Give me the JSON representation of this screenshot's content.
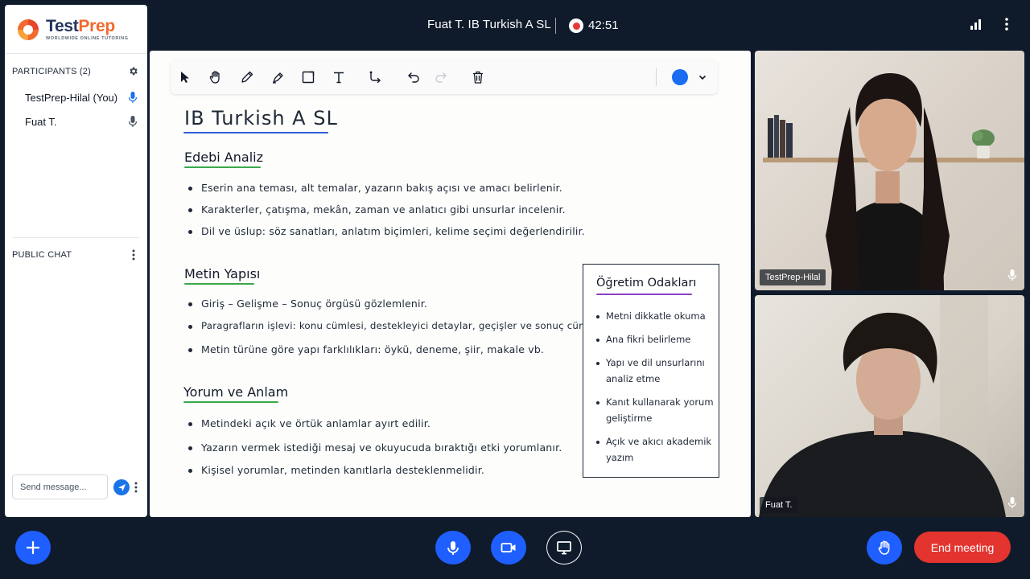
{
  "header": {
    "meeting_title": "Fuat T. IB Turkish A SL",
    "timer": "42:51",
    "icons": [
      "recording-icon",
      "signal-icon",
      "more-vertical-icon"
    ]
  },
  "sidebar": {
    "logo": {
      "text_main": "Test",
      "text_accent": "Prep",
      "tagline": "WORLDWIDE ONLINE TUTORING"
    },
    "participants_title": "PARTICIPANTS (2)",
    "participants": [
      {
        "name": "TestPrep-Hilal (You)",
        "mic_active": true
      },
      {
        "name": "Fuat T.",
        "mic_active": false
      }
    ],
    "chat_title": "PUBLIC CHAT",
    "chat_placeholder": "Send message..."
  },
  "whiteboard": {
    "toolbar": {
      "tools": [
        "select-tool",
        "pan-tool",
        "pencil-tool",
        "highlighter-tool",
        "shape-tool",
        "text-tool",
        "connector-tool",
        "undo",
        "redo",
        "delete"
      ],
      "active_color": "#1a6cf0"
    },
    "title": "IB Turkish A SL",
    "sections": [
      {
        "heading": "Edebi Analiz",
        "bullets": [
          "Eserin ana teması, alt temalar, yazarın bakış açısı ve amacı belirlenir.",
          "Karakterler, çatışma, mekân, zaman ve anlatıcı gibi unsurlar incelenir.",
          "Dil ve üslup: söz sanatları, anlatım biçimleri, kelime seçimi değerlendirilir."
        ]
      },
      {
        "heading": "Metin Yapısı",
        "bullets": [
          "Giriş – Gelişme – Sonuç örgüsü gözlemlenir.",
          "Paragrafların işlevi: konu cümlesi, destekleyici detaylar, geçişler ve sonuç cümlesi.",
          "Metin türüne göre yapı farklılıkları: öykü, deneme, şiir, makale vb."
        ]
      },
      {
        "heading": "Yorum ve Anlam",
        "bullets": [
          "Metindeki açık ve örtük anlamlar ayırt edilir.",
          "Yazarın vermek istediği mesaj ve okuyucuda bıraktığı etki yorumlanır.",
          "Kişisel yorumlar, metinden kanıtlarla desteklenmelidir."
        ]
      }
    ],
    "focus_box": {
      "title": "Öğretim Odakları",
      "items": [
        "Metni dikkatle okuma",
        "Ana fikri belirleme",
        "Yapı ve dil unsurlarını analiz etme",
        "Kanıt kullanarak yorum geliştirme",
        "Açık ve akıcı akademik yazım"
      ]
    }
  },
  "videos": [
    {
      "name": "TestPrep-Hilal"
    },
    {
      "name": "Fuat T."
    }
  ],
  "controls": {
    "end_label": "End meeting",
    "buttons": [
      "add-button",
      "mic-button",
      "camera-button",
      "screen-share-button",
      "raise-hand-button"
    ]
  }
}
